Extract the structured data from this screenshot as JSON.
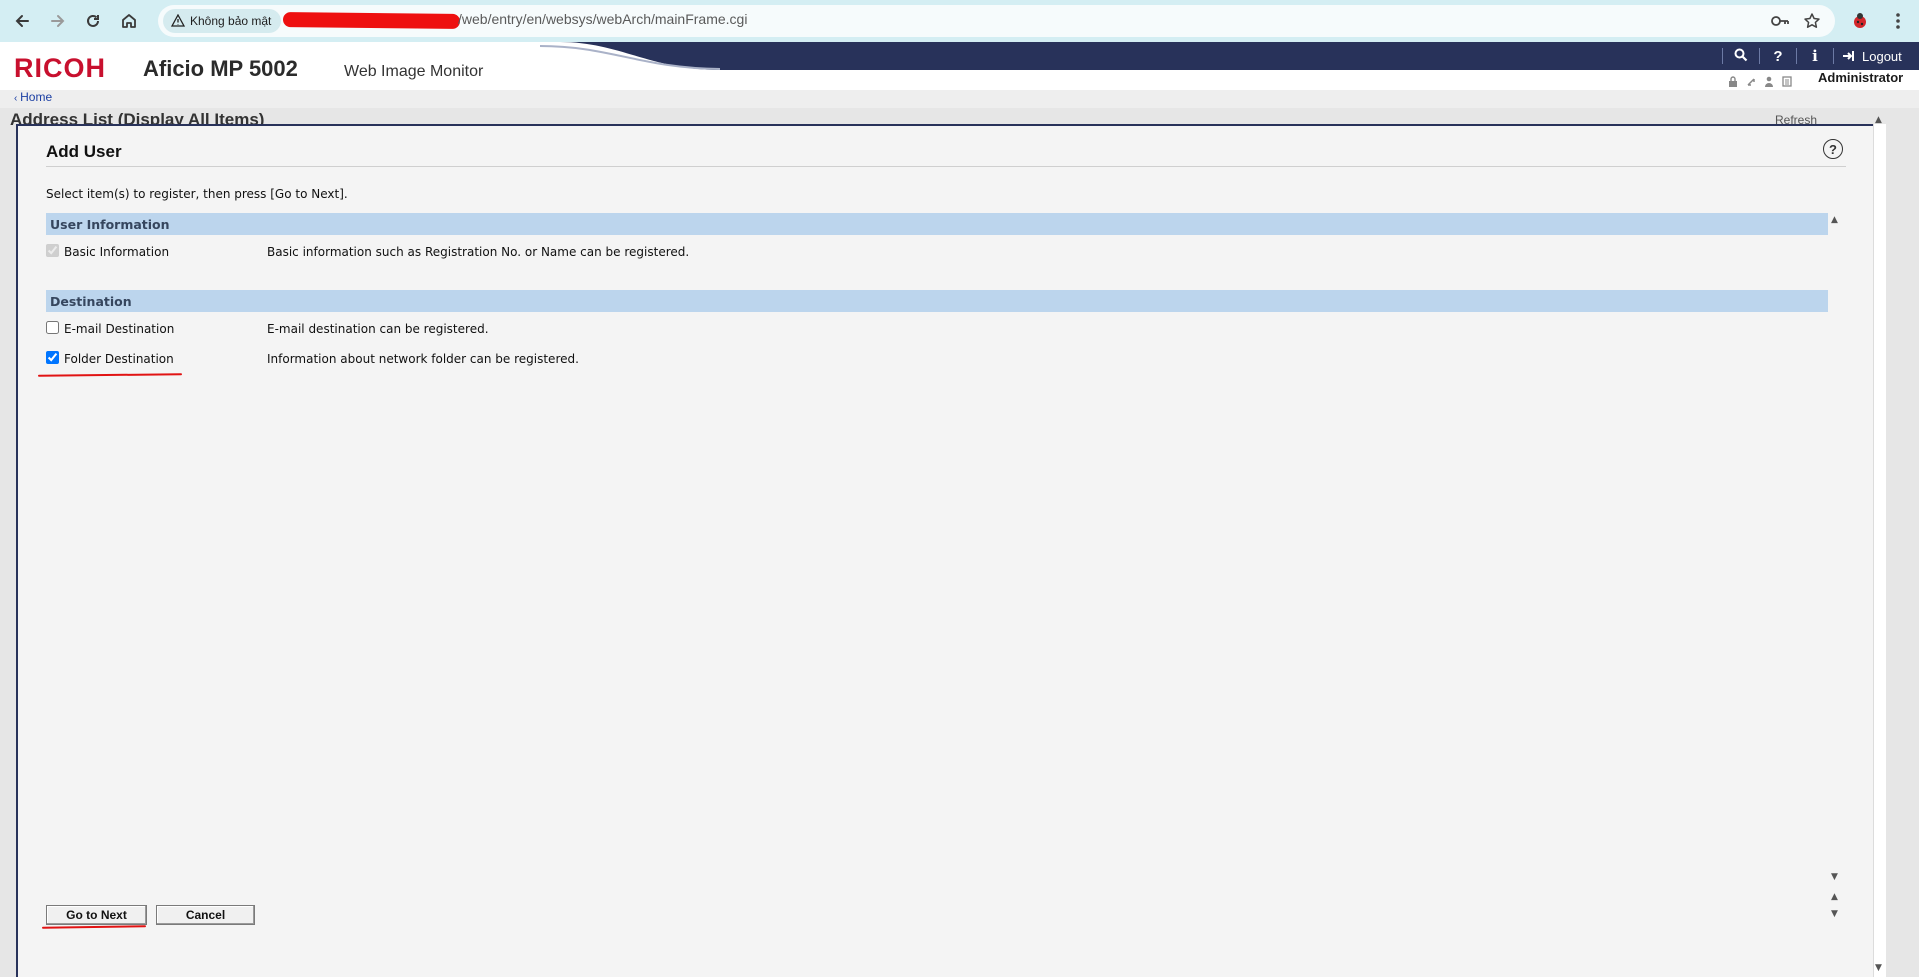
{
  "browser": {
    "security_label": "Không bảo mật",
    "url_path": "/web/entry/en/websys/webArch/mainFrame.cgi"
  },
  "header": {
    "brand": "RICOH",
    "model": "Aficio MP 5002",
    "product": "Web Image Monitor",
    "logout_label": "Logout",
    "user_label": "Administrator",
    "home_label": "Home"
  },
  "background_page": {
    "title": "Address List (Display All Items)",
    "refresh_label": "Refresh"
  },
  "dialog": {
    "title": "Add User",
    "instruction": "Select item(s) to register, then press [Go to Next].",
    "sections": [
      {
        "header": "User Information",
        "items": [
          {
            "label": "Basic Information",
            "description": "Basic information such as Registration No. or Name can be registered.",
            "checked": true,
            "disabled": true
          }
        ]
      },
      {
        "header": "Destination",
        "items": [
          {
            "label": "E-mail Destination",
            "description": "E-mail destination can be registered.",
            "checked": false,
            "disabled": false
          },
          {
            "label": "Folder Destination",
            "description": "Information about network folder can be registered.",
            "checked": true,
            "disabled": false
          }
        ]
      }
    ],
    "buttons": {
      "next_label": "Go to Next",
      "cancel_label": "Cancel"
    }
  },
  "colors": {
    "brand_red": "#c8102e",
    "header_navy": "#28325a",
    "section_blue": "#bcd5ed",
    "annotation_red": "#e11313"
  }
}
